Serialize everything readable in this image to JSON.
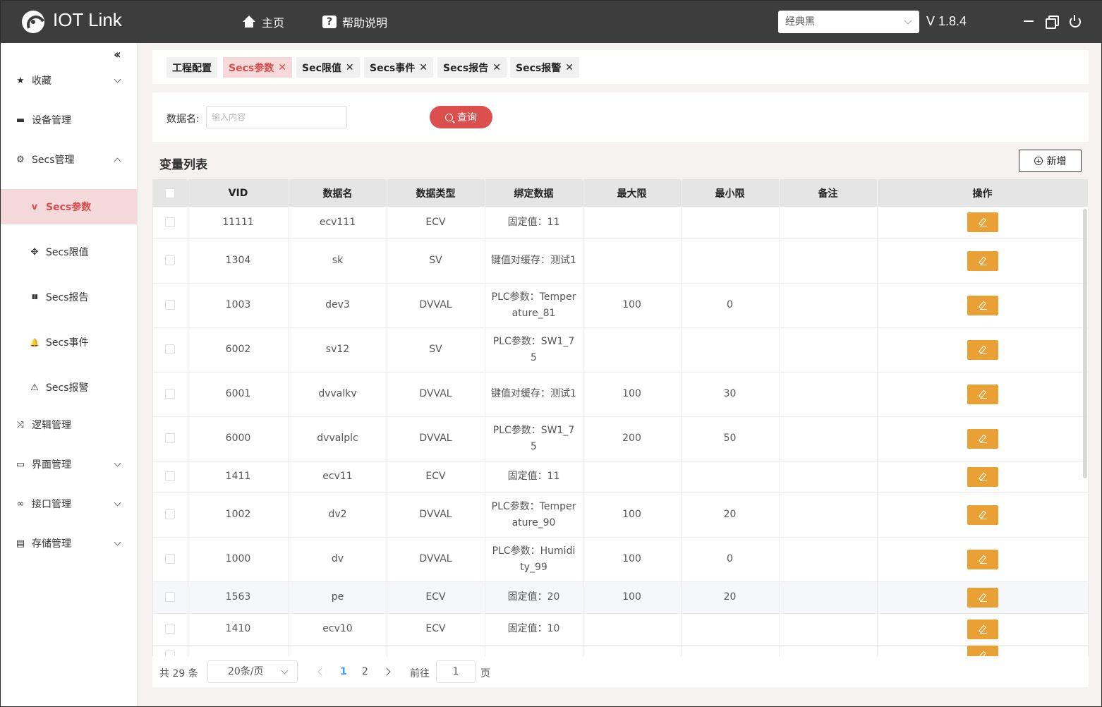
{
  "header": {
    "app_title": "IOT Link",
    "nav_home": "主页",
    "nav_help": "帮助说明",
    "theme_value": "经典黑",
    "version": "V 1.8.4"
  },
  "sidebar": {
    "items": [
      {
        "label": "收藏",
        "icon": "star-icon",
        "glyph": "★"
      },
      {
        "label": "设备管理",
        "icon": "device-icon",
        "glyph": "▬"
      },
      {
        "label": "Secs管理",
        "icon": "chip-icon",
        "glyph": "⚙"
      },
      {
        "label": "Secs参数",
        "icon": "v-icon",
        "glyph": "v"
      },
      {
        "label": "Secs限值",
        "icon": "move-icon",
        "glyph": "✥"
      },
      {
        "label": "Secs报告",
        "icon": "book-icon",
        "glyph": "▮▮"
      },
      {
        "label": "Secs事件",
        "icon": "bell-icon",
        "glyph": "🔔"
      },
      {
        "label": "Secs报警",
        "icon": "warning-icon",
        "glyph": "⚠"
      },
      {
        "label": "逻辑管理",
        "icon": "shuffle-icon",
        "glyph": "⤨"
      },
      {
        "label": "界面管理",
        "icon": "monitor-icon",
        "glyph": "▭"
      },
      {
        "label": "接口管理",
        "icon": "link-icon",
        "glyph": "∞"
      },
      {
        "label": "存储管理",
        "icon": "store-icon",
        "glyph": "▤"
      }
    ]
  },
  "tabs": [
    {
      "label": "工程配置",
      "closable": false,
      "active": false
    },
    {
      "label": "Secs参数",
      "closable": true,
      "active": true
    },
    {
      "label": "Sec限值",
      "closable": true,
      "active": false
    },
    {
      "label": "Secs事件",
      "closable": true,
      "active": false
    },
    {
      "label": "Secs报告",
      "closable": true,
      "active": false
    },
    {
      "label": "Secs报警",
      "closable": true,
      "active": false
    }
  ],
  "search": {
    "label": "数据名:",
    "placeholder": "输入内容",
    "button_label": "查询"
  },
  "list": {
    "title": "变量列表",
    "add_label": "新增",
    "columns": [
      "VID",
      "数据名",
      "数据类型",
      "绑定数据",
      "最大限",
      "最小限",
      "备注",
      "操作"
    ],
    "rows": [
      {
        "vid": "11111",
        "name": "ecv111",
        "type": "ECV",
        "binding": "固定值：11",
        "max": "",
        "min": "",
        "note": ""
      },
      {
        "vid": "1304",
        "name": "sk",
        "type": "SV",
        "binding": "键值对缓存：测试1",
        "max": "",
        "min": "",
        "note": ""
      },
      {
        "vid": "1003",
        "name": "dev3",
        "type": "DVVAL",
        "binding": "PLC参数：Temperature_81",
        "max": "100",
        "min": "0",
        "note": ""
      },
      {
        "vid": "6002",
        "name": "sv12",
        "type": "SV",
        "binding": "PLC参数：SW1_75",
        "max": "",
        "min": "",
        "note": ""
      },
      {
        "vid": "6001",
        "name": "dvvalkv",
        "type": "DVVAL",
        "binding": "键值对缓存：测试1",
        "max": "100",
        "min": "30",
        "note": ""
      },
      {
        "vid": "6000",
        "name": "dvvalplc",
        "type": "DVVAL",
        "binding": "PLC参数：SW1_75",
        "max": "200",
        "min": "50",
        "note": ""
      },
      {
        "vid": "1411",
        "name": "ecv11",
        "type": "ECV",
        "binding": "固定值：11",
        "max": "",
        "min": "",
        "note": ""
      },
      {
        "vid": "1002",
        "name": "dv2",
        "type": "DVVAL",
        "binding": "PLC参数：Temperature_90",
        "max": "100",
        "min": "20",
        "note": ""
      },
      {
        "vid": "1000",
        "name": "dv",
        "type": "DVVAL",
        "binding": "PLC参数：Humidity_99",
        "max": "100",
        "min": "0",
        "note": ""
      },
      {
        "vid": "1563",
        "name": "pe",
        "type": "ECV",
        "binding": "固定值：20",
        "max": "100",
        "min": "20",
        "note": ""
      },
      {
        "vid": "1410",
        "name": "ecv10",
        "type": "ECV",
        "binding": "固定值：10",
        "max": "",
        "min": "",
        "note": ""
      },
      {
        "vid": "",
        "name": "",
        "type": "",
        "binding": "",
        "max": "",
        "min": "",
        "note": ""
      }
    ]
  },
  "pagination": {
    "total": "共 29 条",
    "page_size": "20条/页",
    "pages": [
      "1",
      "2"
    ],
    "current": "1",
    "goto_label": "前往",
    "goto_value": "1",
    "page_suffix": "页"
  }
}
